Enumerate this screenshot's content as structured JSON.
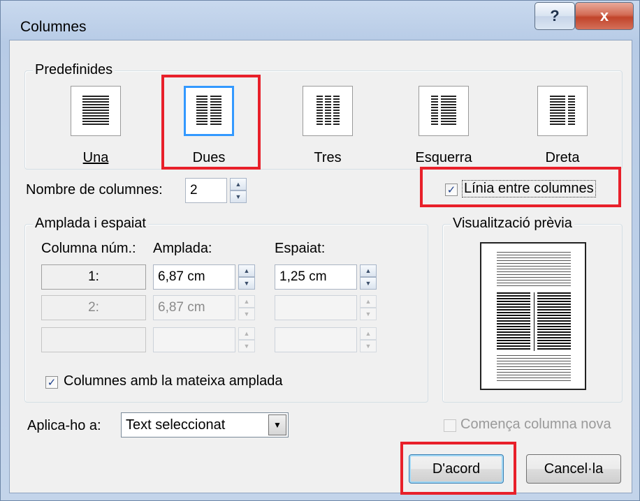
{
  "window": {
    "title": "Columnes",
    "help_label": "?",
    "close_label": "x"
  },
  "presets": {
    "group_label": "Predefinides",
    "items": [
      {
        "label": "Una",
        "selected": false
      },
      {
        "label": "Dues",
        "selected": true
      },
      {
        "label": "Tres",
        "selected": false
      },
      {
        "label": "Esquerra",
        "selected": false
      },
      {
        "label": "Dreta",
        "selected": false
      }
    ]
  },
  "num_columns": {
    "label": "Nombre de columnes:",
    "value": "2"
  },
  "line_between": {
    "label": "Línia entre columnes",
    "checked": true
  },
  "width_spacing": {
    "group_label": "Amplada i espaiat",
    "col_header": "Columna núm.:",
    "width_header": "Amplada:",
    "spacing_header": "Espaiat:",
    "rows": [
      {
        "num": "1:",
        "width": "6,87 cm",
        "spacing": "1,25 cm"
      },
      {
        "num": "2:",
        "width": "6,87 cm",
        "spacing": ""
      },
      {
        "num": "",
        "width": "",
        "spacing": ""
      }
    ],
    "equal_width_label": "Columnes amb la mateixa amplada",
    "equal_width_checked": true
  },
  "preview": {
    "group_label": "Visualització prèvia"
  },
  "apply_to": {
    "label": "Aplica-ho a:",
    "value": "Text seleccionat"
  },
  "new_column": {
    "label": "Comença columna nova",
    "checked": false
  },
  "buttons": {
    "ok": "D'acord",
    "cancel": "Cancel·la"
  },
  "colors": {
    "highlight": "#e8202a",
    "selection": "#3399ff"
  }
}
